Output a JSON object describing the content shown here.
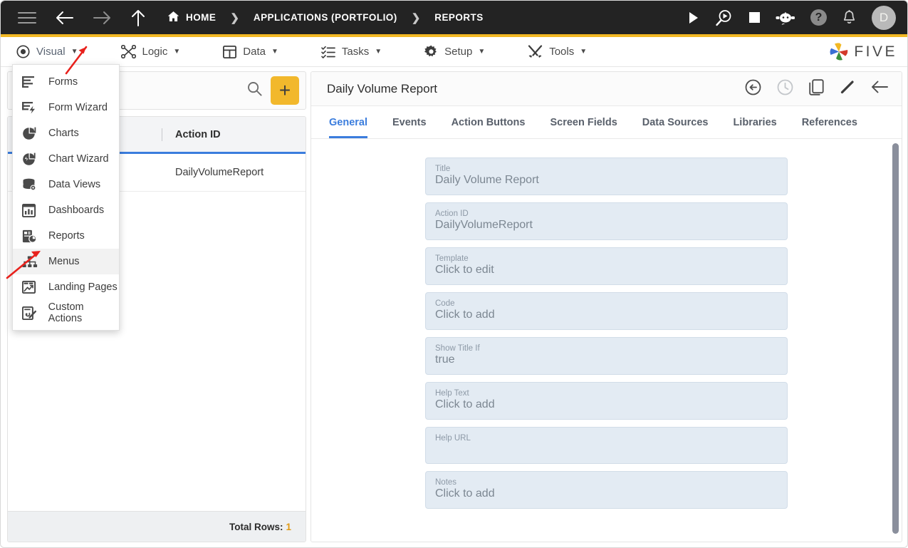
{
  "topbar": {
    "menu_icon": "hamburger-icon",
    "back_label": "←",
    "forward_label": "→",
    "up_label": "↑",
    "breadcrumbs": [
      {
        "label": "HOME",
        "icon": "home-icon"
      },
      {
        "label": "APPLICATIONS (PORTFOLIO)",
        "icon": ""
      },
      {
        "label": "REPORTS",
        "icon": ""
      }
    ],
    "separator": "❯",
    "actions": [
      {
        "name": "run-icon",
        "label": "▶"
      },
      {
        "name": "debug-icon",
        "label": ""
      },
      {
        "name": "stop-icon",
        "label": "■"
      },
      {
        "name": "chatbot-icon",
        "label": ""
      },
      {
        "name": "help-icon",
        "label": "?"
      },
      {
        "name": "notifications-bell-icon",
        "label": ""
      }
    ],
    "avatar_initial": "D"
  },
  "menubar": {
    "items": [
      {
        "label": "Visual",
        "icon": "eye-icon",
        "caret": "▼",
        "active": true
      },
      {
        "label": "Logic",
        "icon": "logic-nodes-icon",
        "caret": "▼",
        "active": false
      },
      {
        "label": "Data",
        "icon": "table-grid-icon",
        "caret": "▼",
        "active": false
      },
      {
        "label": "Tasks",
        "icon": "task-list-icon",
        "caret": "▼",
        "active": false
      },
      {
        "label": "Setup",
        "icon": "gear-icon",
        "caret": "▼",
        "active": false
      },
      {
        "label": "Tools",
        "icon": "tools-icon",
        "caret": "▼",
        "active": false
      }
    ],
    "logo_text": "FIVE"
  },
  "visual_dropdown": {
    "items": [
      {
        "label": "Forms",
        "icon": "forms-icon",
        "highlighted": false
      },
      {
        "label": "Form Wizard",
        "icon": "form-wizard-icon",
        "highlighted": false
      },
      {
        "label": "Charts",
        "icon": "charts-icon",
        "highlighted": false
      },
      {
        "label": "Chart Wizard",
        "icon": "chart-wizard-icon",
        "highlighted": false
      },
      {
        "label": "Data Views",
        "icon": "data-views-icon",
        "highlighted": false
      },
      {
        "label": "Dashboards",
        "icon": "dashboards-icon",
        "highlighted": false
      },
      {
        "label": "Reports",
        "icon": "reports-icon",
        "highlighted": false
      },
      {
        "label": "Menus",
        "icon": "menus-icon",
        "highlighted": true
      },
      {
        "label": "Landing Pages",
        "icon": "landing-pages-icon",
        "highlighted": false
      },
      {
        "label": "Custom Actions",
        "icon": "custom-actions-icon",
        "highlighted": false
      }
    ]
  },
  "left_panel": {
    "search_icon": "search-icon",
    "add_label": "+",
    "columns": [
      "Action ID"
    ],
    "rows": [
      {
        "action_id": "DailyVolumeReport"
      }
    ],
    "total_rows_label": "Total Rows:",
    "total_rows_count": "1"
  },
  "right_panel": {
    "title": "Daily Volume Report",
    "actions": [
      {
        "name": "revert-icon"
      },
      {
        "name": "history-clock-icon"
      },
      {
        "name": "duplicate-icon"
      },
      {
        "name": "edit-pencil-icon"
      },
      {
        "name": "back-arrow-icon"
      }
    ],
    "tabs": [
      {
        "label": "General",
        "selected": true
      },
      {
        "label": "Events",
        "selected": false
      },
      {
        "label": "Action Buttons",
        "selected": false
      },
      {
        "label": "Screen Fields",
        "selected": false
      },
      {
        "label": "Data Sources",
        "selected": false
      },
      {
        "label": "Libraries",
        "selected": false
      },
      {
        "label": "References",
        "selected": false
      }
    ],
    "fields": [
      {
        "label": "Title",
        "value": "Daily Volume Report"
      },
      {
        "label": "Action ID",
        "value": "DailyVolumeReport"
      },
      {
        "label": "Template",
        "value": "Click to edit"
      },
      {
        "label": "Code",
        "value": "Click to add"
      },
      {
        "label": "Show Title If",
        "value": "true"
      },
      {
        "label": "Help Text",
        "value": "Click to add"
      },
      {
        "label": "Help URL",
        "value": ""
      },
      {
        "label": "Notes",
        "value": "Click to add"
      }
    ]
  },
  "colors": {
    "accent_yellow": "#f2b824",
    "accent_blue": "#3b7ddd",
    "topbar_dark": "#232323",
    "field_bg": "#e3ebf3",
    "annotation_red": "#e8211c"
  }
}
